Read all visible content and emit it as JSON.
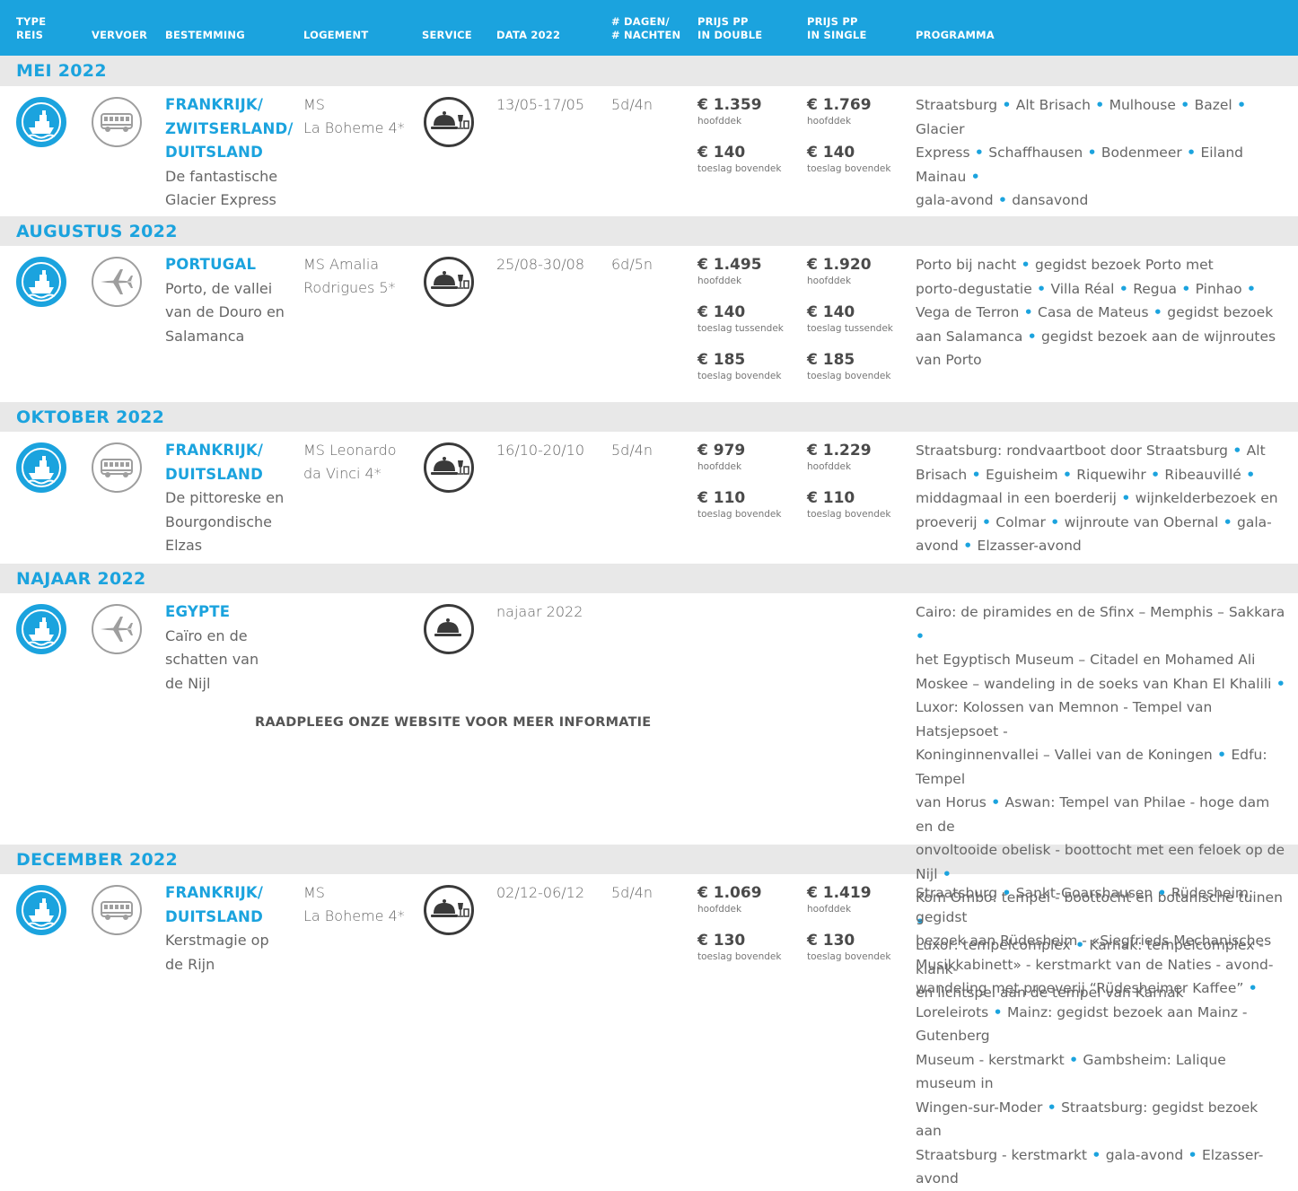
{
  "header": {
    "col_type": [
      "TYPE",
      "REIS"
    ],
    "col_vervoer": "VERVOER",
    "col_bestemming": "BESTEMMING",
    "col_logement": "LOGEMENT",
    "col_service": "SERVICE",
    "col_data": "DATA 2022",
    "col_dagen": [
      "# DAGEN/",
      "# NACHTEN"
    ],
    "col_double": [
      "PRIJS PP",
      "IN DOUBLE"
    ],
    "col_single": [
      "PRIJS PP",
      "IN SINGLE"
    ],
    "col_programma": "PROGRAMMA"
  },
  "colors": {
    "accent": "#1ba3de",
    "band": "#e8e8e8",
    "icon_grey": "#9e9e9e",
    "service_dark": "#3a3a3a"
  },
  "months": [
    "MEI 2022",
    "AUGUSTUS 2022",
    "OKTOBER 2022",
    "NAJAAR 2022",
    "DECEMBER 2022"
  ],
  "trips": [
    {
      "type_icon": "cruise-ship-icon",
      "transport_icon": "bus-icon",
      "service_icon": "full-board-wine-icon",
      "dest_lines": [
        "FRANKRIJK/",
        "ZWITSERLAND/",
        "DUITSLAND"
      ],
      "sub_lines": [
        "De fantastische",
        "Glacier Express"
      ],
      "logement_lines": [
        "MS",
        "La Boheme 4*"
      ],
      "dates": "13/05-17/05",
      "days": "5d/4n",
      "double": [
        {
          "amount": "€ 1.359",
          "label": "hoofddek"
        },
        {
          "amount": "€ 140",
          "label": "toeslag bovendek"
        }
      ],
      "single": [
        {
          "amount": "€ 1.769",
          "label": "hoofddek"
        },
        {
          "amount": "€ 140",
          "label": "toeslag bovendek"
        }
      ],
      "program_lines": [
        [
          "Straatsburg",
          "Alt Brisach",
          "Mulhouse",
          "Bazel",
          "Glacier"
        ],
        [
          "Express",
          "Schaffhausen",
          "Bodenmeer",
          "Eiland Mainau",
          ""
        ],
        [
          "gala-avond",
          "dansavond"
        ]
      ]
    },
    {
      "type_icon": "cruise-ship-icon",
      "transport_icon": "airplane-icon",
      "service_icon": "full-board-wine-icon",
      "dest_lines": [
        "PORTUGAL"
      ],
      "sub_lines": [
        "Porto, de vallei",
        "van de Douro en",
        "Salamanca"
      ],
      "logement_lines": [
        "MS Amalia",
        "Rodrigues 5*"
      ],
      "dates": "25/08-30/08",
      "days": "6d/5n",
      "double": [
        {
          "amount": "€ 1.495",
          "label": "hoofddek"
        },
        {
          "amount": "€ 140",
          "label": "toeslag tussendek"
        },
        {
          "amount": "€ 185",
          "label": "toeslag bovendek"
        }
      ],
      "single": [
        {
          "amount": "€ 1.920",
          "label": "hoofddek"
        },
        {
          "amount": "€ 140",
          "label": "toeslag tussendek"
        },
        {
          "amount": "€ 185",
          "label": "toeslag bovendek"
        }
      ],
      "program_lines": [
        [
          "Porto bij nacht",
          "gegidst bezoek Porto met"
        ],
        [
          "porto-degustatie",
          "Villa Réal",
          "Regua",
          "Pinhao",
          ""
        ],
        [
          "Vega de Terron",
          "Casa de Mateus",
          "gegidst bezoek"
        ],
        [
          "aan Salamanca",
          "gegidst bezoek aan de wijnroutes"
        ],
        [
          "van Porto"
        ]
      ]
    },
    {
      "type_icon": "cruise-ship-icon",
      "transport_icon": "bus-icon",
      "service_icon": "full-board-wine-icon",
      "dest_lines": [
        "FRANKRIJK/",
        "DUITSLAND"
      ],
      "sub_lines": [
        "De pittoreske en",
        "Bourgondische",
        "Elzas"
      ],
      "logement_lines": [
        "MS Leonardo",
        "da Vinci 4*"
      ],
      "dates": "16/10-20/10",
      "days": "5d/4n",
      "double": [
        {
          "amount": "€ 979",
          "label": "hoofddek"
        },
        {
          "amount": "€ 110",
          "label": "toeslag bovendek"
        }
      ],
      "single": [
        {
          "amount": "€ 1.229",
          "label": "hoofddek"
        },
        {
          "amount": "€ 110",
          "label": "toeslag bovendek"
        }
      ],
      "program_lines": [
        [
          "Straatsburg: rondvaartboot door Straatsburg",
          "Alt"
        ],
        [
          "Brisach",
          "Eguisheim",
          "Riquewihr",
          "Ribeauvillé",
          ""
        ],
        [
          "middagmaal in een boerderij",
          "wijnkelderbezoek en"
        ],
        [
          "proeverij",
          "Colmar",
          "wijnroute van Obernal",
          "gala-"
        ],
        [
          "avond",
          "Elzasser-avond"
        ]
      ]
    },
    {
      "type_icon": "cruise-ship-icon",
      "transport_icon": "airplane-icon",
      "service_icon": "full-board-icon",
      "dest_lines": [
        "EGYPTE"
      ],
      "sub_lines": [
        "Caïro en de",
        "schatten van",
        "de Nijl"
      ],
      "logement_lines": [],
      "dates": "najaar 2022",
      "days": "",
      "double": [],
      "single": [],
      "program_lines": [
        [
          "Cairo: de piramides en de Sfinx – Memphis – Sakkara",
          ""
        ],
        [
          "het Egyptisch Museum – Citadel en Mohamed Ali"
        ],
        [
          "Moskee – wandeling in de soeks van Khan El Khalili",
          ""
        ],
        [
          "Luxor: Kolossen van Memnon - Tempel van Hatsjepsoet -"
        ],
        [
          "Koninginnenvallei – Vallei van de Koningen",
          "Edfu: Tempel"
        ],
        [
          "van Horus",
          "Aswan: Tempel van Philae - hoge dam en de"
        ],
        [
          "onvoltooide obelisk - boottocht met een feloek op de Nijl",
          ""
        ],
        [
          "Kom Ombo: tempel - boottocht en botanische tuinen",
          ""
        ],
        [
          "Luxor: tempelcomplex",
          "Karnak: tempelcomplex - klank-"
        ],
        [
          "en lichtspel aan de tempel van Karnak"
        ]
      ]
    },
    {
      "type_icon": "cruise-ship-icon",
      "transport_icon": "bus-icon",
      "service_icon": "full-board-wine-icon",
      "dest_lines": [
        "FRANKRIJK/",
        "DUITSLAND"
      ],
      "sub_lines": [
        "Kerstmagie op",
        "de Rijn"
      ],
      "logement_lines": [
        "MS",
        "La Boheme 4*"
      ],
      "dates": "02/12-06/12",
      "days": "5d/4n",
      "double": [
        {
          "amount": "€ 1.069",
          "label": "hoofddek"
        },
        {
          "amount": "€ 130",
          "label": "toeslag bovendek"
        }
      ],
      "single": [
        {
          "amount": "€ 1.419",
          "label": "hoofddek"
        },
        {
          "amount": "€ 130",
          "label": "toeslag bovendek"
        }
      ],
      "program_lines": [
        [
          "Straatsburg",
          "Sankt-Goarshausen",
          "Rüdesheim: gegidst"
        ],
        [
          "bezoek aan Rüdesheim - «Siegfrieds Mechanisches"
        ],
        [
          "Musikkabinett» - kerstmarkt van de Naties - avond-"
        ],
        [
          "wandeling met proeverij  “Rüdesheimer Kaffee”",
          ""
        ],
        [
          "Loreleirots",
          "Mainz: gegidst bezoek aan Mainz - Gutenberg"
        ],
        [
          "Museum - kerstmarkt",
          "Gambsheim: Lalique museum in"
        ],
        [
          "Wingen-sur-Moder",
          "Straatsburg: gegidst bezoek aan"
        ],
        [
          "Straatsburg - kerstmarkt",
          "gala-avond",
          "Elzasser-avond"
        ]
      ]
    }
  ],
  "note": "RAADPLEEG ONZE WEBSITE VOOR MEER INFORMATIE"
}
